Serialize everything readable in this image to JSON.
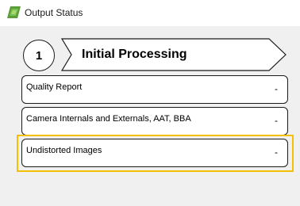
{
  "window": {
    "title": "Output Status",
    "icon": "app-logo-icon"
  },
  "step": {
    "number": "1",
    "title": "Initial Processing"
  },
  "sections": [
    {
      "label": "Quality Report",
      "status": "-"
    },
    {
      "label": "Camera Internals and Externals, AAT, BBA",
      "status": "-"
    },
    {
      "label": "Undistorted Images",
      "status": "-"
    }
  ],
  "colors": {
    "highlight": "#f5c000",
    "panel_bg": "#f0f0f0",
    "logo_green": "#5a9e3a"
  }
}
